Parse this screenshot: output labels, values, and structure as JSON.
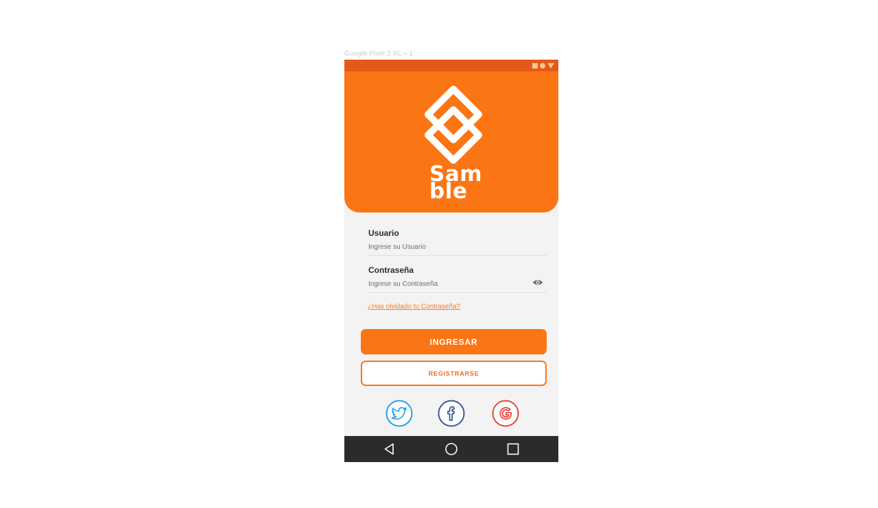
{
  "artboard": {
    "label": "Google Pixel 2 XL – 1"
  },
  "status_bar": {
    "icons": [
      "square-icon",
      "circle-icon",
      "triangle-icon"
    ]
  },
  "brand": {
    "logo_icon": "stacked-diamonds-logo",
    "wordmark_line1": "Sam",
    "wordmark_line2": "ble"
  },
  "form": {
    "username": {
      "label": "Usuario",
      "placeholder": "Ingrese su Usuario",
      "value": ""
    },
    "password": {
      "label": "Contraseña",
      "placeholder": "Ingrese su Contraseña",
      "value": "",
      "toggle_icon": "eye-icon"
    },
    "forgot_link": "¿Has olvidado tu Contraseña?"
  },
  "actions": {
    "login_label": "INGRESAR",
    "register_label": "REGISTRARSE"
  },
  "social": [
    {
      "name": "Twitter",
      "icon": "twitter-icon",
      "color": "#1da1f2"
    },
    {
      "name": "Facebook",
      "icon": "facebook-icon",
      "color": "#3b5998"
    },
    {
      "name": "Google",
      "icon": "google-icon",
      "color": "#e8453c"
    }
  ],
  "nav_bar": {
    "buttons": [
      "back-icon",
      "home-icon",
      "recents-icon"
    ]
  },
  "colors": {
    "primary": "#fb7514",
    "status_bar": "#e4591a",
    "background": "#f3f3f3",
    "nav_bar": "#2b2b2b"
  }
}
